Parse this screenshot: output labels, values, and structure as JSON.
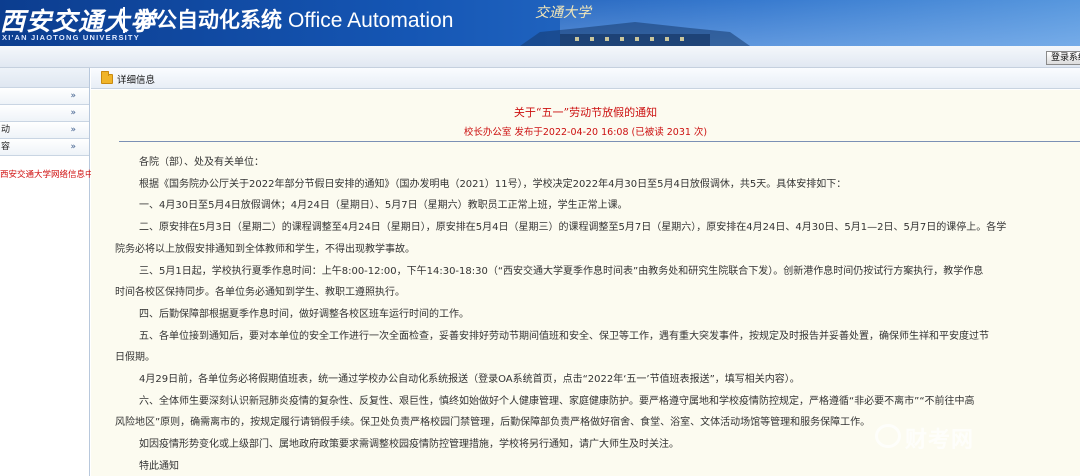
{
  "header": {
    "university_name": "西安交通大学",
    "university_name_en": "XI'AN JIAOTONG UNIVERSITY",
    "system_title_cn": "办公自动化系统",
    "system_title_en": "Office Automation",
    "roof_sign": "交通大学"
  },
  "topbar": {
    "logout_label": "登录系统"
  },
  "sidebar": {
    "items": [
      {
        "label": "",
        "arrow": "»"
      },
      {
        "label": "",
        "arrow": "»"
      },
      {
        "label": "动",
        "arrow": "»"
      },
      {
        "label": "容",
        "arrow": "»"
      }
    ],
    "link": "西安交通大学网络信息中心"
  },
  "tabbar": {
    "label": "详细信息"
  },
  "notice": {
    "title": "关于“五一”劳动节放假的通知",
    "meta": "校长办公室 发布于2022-04-20 16:08 (已被读 2031 次)",
    "paragraphs": [
      "各院（部）、处及有关单位：",
      "根据《国务院办公厅关于2022年部分节假日安排的通知》（国办发明电（2021）11号），学校决定2022年4月30日至5月4日放假调休，共5天。具体安排如下：",
      "一、4月30日至5月4日放假调休；4月24日（星期日）、5月7日（星期六）教职员工正常上班，学生正常上课。",
      "二、原安排在5月3日（星期二）的课程调整至4月24日（星期日），原安排在5月4日（星期三）的课程调整至5月7日（星期六），原安排在4月24日、4月30日、5月1—2日、5月7日的课停上。各学",
      "院务必将以上放假安排通知到全体教师和学生，不得出现教学事故。",
      "三、5月1日起，学校执行夏季作息时间：上午8:00-12:00，下午14:30-18:30（“西安交通大学夏季作息时间表”由教务处和研究生院联合下发）。创新港作息时间仍按试行方案执行，教学作息",
      "时间各校区保持同步。各单位务必通知到学生、教职工遵照执行。",
      "四、后勤保障部根据夏季作息时间，做好调整各校区班车运行时间的工作。",
      "五、各单位接到通知后，要对本单位的安全工作进行一次全面检查，妥善安排好劳动节期间值班和安全、保卫等工作，遇有重大突发事件，按规定及时报告并妥善处置，确保师生祥和平安度过节",
      "日假期。",
      "4月29日前，各单位务必将假期值班表，统一通过学校办公自动化系统报送（登录OA系统首页，点击“2022年‘五一’节值班表报送”，填写相关内容）。",
      "六、全体师生要深刻认识新冠肺炎疫情的复杂性、反复性、艰巨性，慎终如始做好个人健康管理、家庭健康防护。要严格遵守属地和学校疫情防控规定，严格遵循“非必要不离市”“不前往中高",
      "风险地区”原则，确需离市的，按规定履行请销假手续。保卫处负责严格校园门禁管理，后勤保障部负责严格做好宿舍、食堂、浴室、文体活动场馆等管理和服务保障工作。",
      "如因疫情形势变化或上级部门、属地政府政策要求需调整校园疫情防控管理措施，学校将另行通知，请广大师生及时关注。",
      "特此通知"
    ]
  },
  "watermark": {
    "text": "财考网"
  }
}
